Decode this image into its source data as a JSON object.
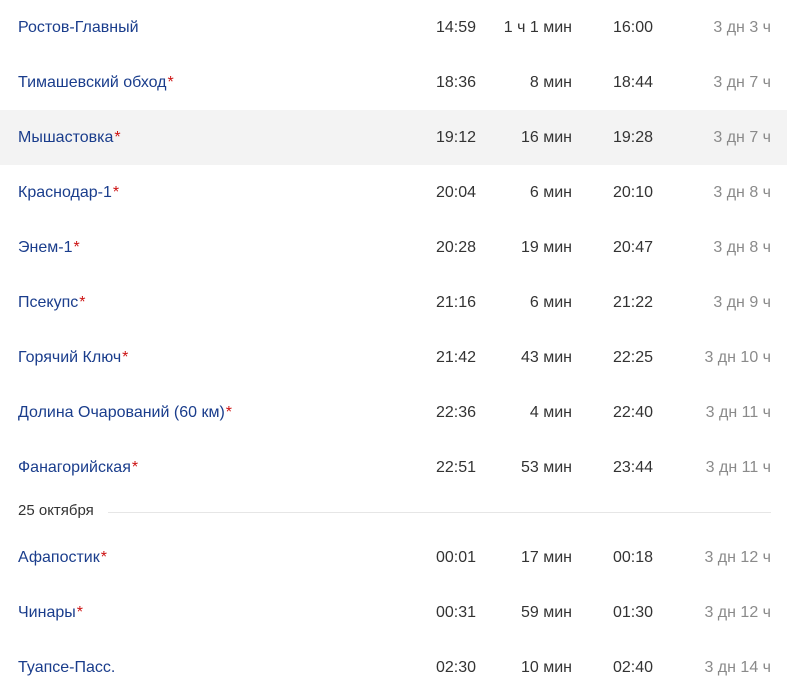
{
  "stations_before": [
    {
      "name": "Ростов-Главный",
      "required": false,
      "arrival": "14:59",
      "stop": "1 ч 1 мин",
      "departure": "16:00",
      "travel": "3 дн 3 ч",
      "highlight": false
    },
    {
      "name": "Тимашевский обход",
      "required": true,
      "arrival": "18:36",
      "stop": "8 мин",
      "departure": "18:44",
      "travel": "3 дн 7 ч",
      "highlight": false
    },
    {
      "name": "Мышастовка",
      "required": true,
      "arrival": "19:12",
      "stop": "16 мин",
      "departure": "19:28",
      "travel": "3 дн 7 ч",
      "highlight": true
    },
    {
      "name": "Краснодар-1",
      "required": true,
      "arrival": "20:04",
      "stop": "6 мин",
      "departure": "20:10",
      "travel": "3 дн 8 ч",
      "highlight": false
    },
    {
      "name": "Энем-1",
      "required": true,
      "arrival": "20:28",
      "stop": "19 мин",
      "departure": "20:47",
      "travel": "3 дн 8 ч",
      "highlight": false
    },
    {
      "name": "Псекупс",
      "required": true,
      "arrival": "21:16",
      "stop": "6 мин",
      "departure": "21:22",
      "travel": "3 дн 9 ч",
      "highlight": false
    },
    {
      "name": "Горячий Ключ",
      "required": true,
      "arrival": "21:42",
      "stop": "43 мин",
      "departure": "22:25",
      "travel": "3 дн 10 ч",
      "highlight": false
    },
    {
      "name": "Долина Очарований (60 км)",
      "required": true,
      "arrival": "22:36",
      "stop": "4 мин",
      "departure": "22:40",
      "travel": "3 дн 11 ч",
      "highlight": false
    },
    {
      "name": "Фанагорийская",
      "required": true,
      "arrival": "22:51",
      "stop": "53 мин",
      "departure": "23:44",
      "travel": "3 дн 11 ч",
      "highlight": false
    }
  ],
  "date_divider": {
    "label": "25 октября"
  },
  "stations_after": [
    {
      "name": "Афапостик",
      "required": true,
      "arrival": "00:01",
      "stop": "17 мин",
      "departure": "00:18",
      "travel": "3 дн 12 ч",
      "highlight": false
    },
    {
      "name": "Чинары",
      "required": true,
      "arrival": "00:31",
      "stop": "59 мин",
      "departure": "01:30",
      "travel": "3 дн 12 ч",
      "highlight": false
    },
    {
      "name": "Туапсе-Пасс.",
      "required": false,
      "arrival": "02:30",
      "stop": "10 мин",
      "departure": "02:40",
      "travel": "3 дн 14 ч",
      "highlight": false
    }
  ],
  "required_marker": "*",
  "colors": {
    "link": "#1a3d8c",
    "required_marker": "#cc1111",
    "highlight_bg": "#f3f3f3",
    "muted_text": "#8a8a8a",
    "divider": "#e6e6e6"
  }
}
